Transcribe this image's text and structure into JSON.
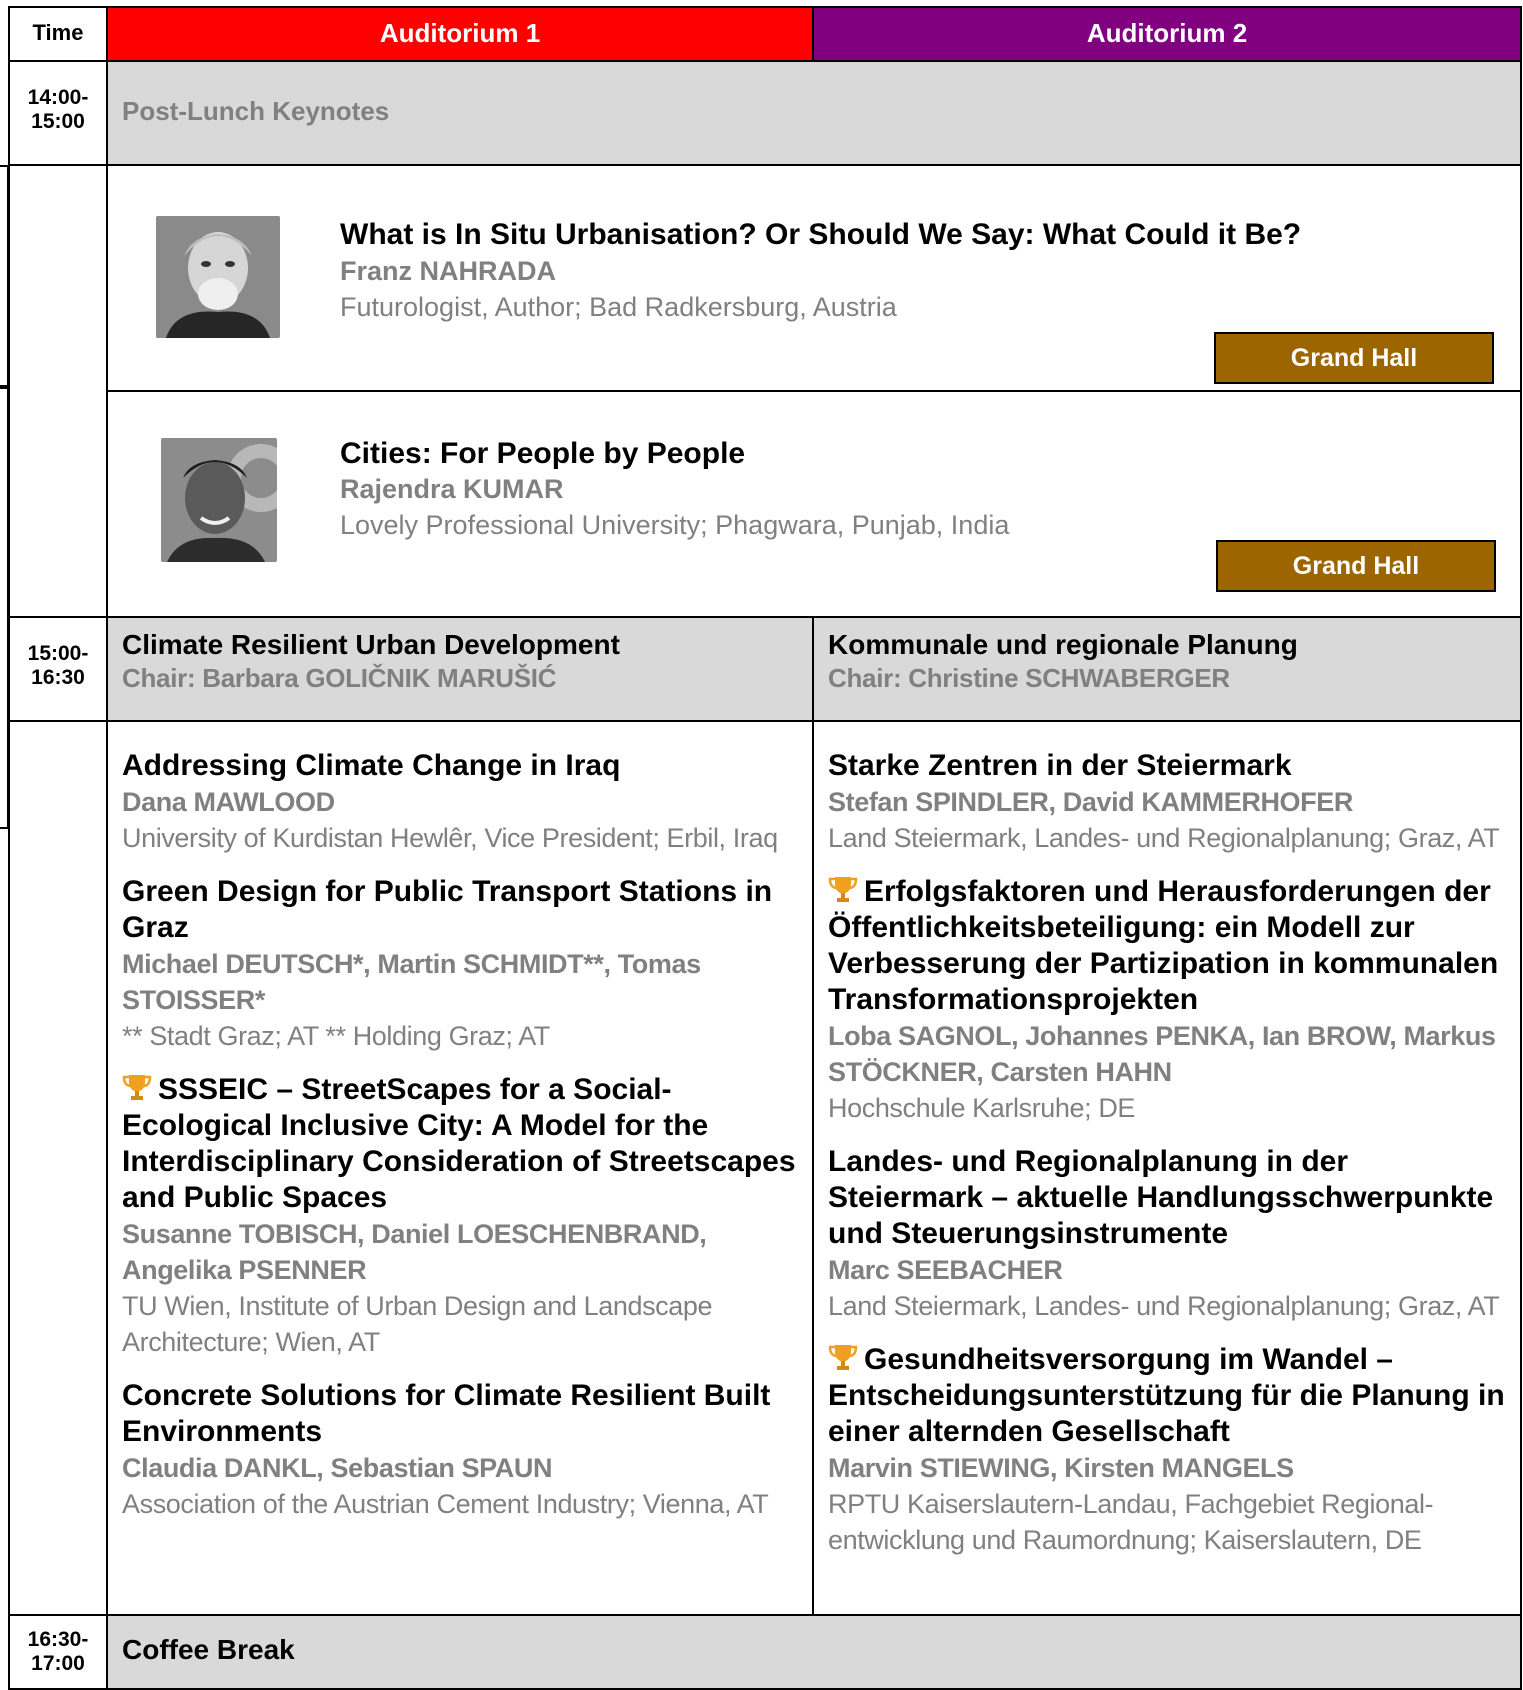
{
  "header": {
    "time_label": "Time",
    "auditorium1": "Auditorium 1",
    "auditorium2": "Auditorium 2",
    "colors": {
      "auditorium1": "#ff0000",
      "auditorium2": "#800080",
      "hall_button": "#9c6500",
      "grey_band": "#d9d9d9"
    }
  },
  "keynote_block": {
    "time": "14:00-\n15:00",
    "label": "Post-Lunch Keynotes",
    "talks": [
      {
        "title": "What is In Situ Urbanisation? Or Should We Say: What Could it Be?",
        "speaker": "Franz NAHRADA",
        "affiliation": "Futurologist, Author; Bad Radkersburg, Austria",
        "hall": "Grand Hall"
      },
      {
        "title": "Cities: For People by People",
        "speaker": "Rajendra KUMAR",
        "affiliation": "Lovely Professional University; Phagwara, Punjab, India",
        "hall": "Grand Hall"
      }
    ]
  },
  "session_block": {
    "time": "15:00-\n16:30",
    "auditorium1": {
      "title": "Climate Resilient Urban Development",
      "chair": "Chair: Barbara GOLIČNIK MARUŠIĆ",
      "papers": [
        {
          "award": false,
          "title": "Addressing Climate Change in Iraq",
          "authors": "Dana MAWLOOD",
          "affiliation": "University of Kurdistan Hewlêr, Vice President; Erbil, Iraq"
        },
        {
          "award": false,
          "title": "Green Design for Public Transport Stations in Graz",
          "authors": "Michael DEUTSCH*, Martin SCHMIDT**, Tomas STOISSER*",
          "affiliation": "** Stadt Graz; AT ** Holding Graz; AT"
        },
        {
          "award": true,
          "title": "SSSEIC – StreetScapes for a Social-Ecological Inclusive City: A Model for the Interdisciplinary Consideration of Streetscapes and Public Spaces",
          "authors": "Susanne TOBISCH, Daniel LOESCHENBRAND, Angelika PSENNER",
          "affiliation": "TU Wien, Institute of Urban Design and Landscape Architecture; Wien, AT"
        },
        {
          "award": false,
          "title": "Concrete Solutions for Climate Resilient Built Environments",
          "authors": "Claudia DANKL, Sebastian SPAUN",
          "affiliation": "Association of the Austrian Cement Industry; Vienna, AT"
        }
      ]
    },
    "auditorium2": {
      "title": "Kommunale und regionale Planung",
      "chair": "Chair: Christine SCHWABERGER",
      "papers": [
        {
          "award": false,
          "title": "Starke Zentren in der Steiermark",
          "authors": "Stefan SPINDLER, David KAMMERHOFER",
          "affiliation": "Land Steiermark, Landes- und Regionalplanung; Graz, AT"
        },
        {
          "award": true,
          "title": "Erfolgsfaktoren und Herausforderungen der Öffentlichkeitsbeteiligung: ein Modell zur Verbesserung der Partizipation in kommunalen Transformationsprojekten",
          "authors": "Loba SAGNOL, Johannes PENKA, Ian BROW, Markus STÖCKNER, Carsten HAHN",
          "affiliation": "Hochschule Karlsruhe; DE"
        },
        {
          "award": false,
          "title": "Landes- und Regionalplanung in der Steiermark – aktuelle Handlungsschwerpunkte und Steuerungsinstrumente",
          "authors": "Marc SEEBACHER",
          "affiliation": "Land Steiermark, Landes- und Regionalplanung; Graz, AT"
        },
        {
          "award": true,
          "title": "Gesundheitsversorgung im Wandel – Entscheidungsunterstützung für die Planung in einer alternden Gesellschaft",
          "authors": "Marvin STIEWING, Kirsten MANGELS",
          "affiliation": "RPTU Kaiserslautern-Landau, Fachgebiet Regional-entwicklung und Raumordnung; Kaiserslautern, DE"
        }
      ]
    }
  },
  "break_block": {
    "time": "16:30-\n17:00",
    "label": "Coffee Break"
  }
}
